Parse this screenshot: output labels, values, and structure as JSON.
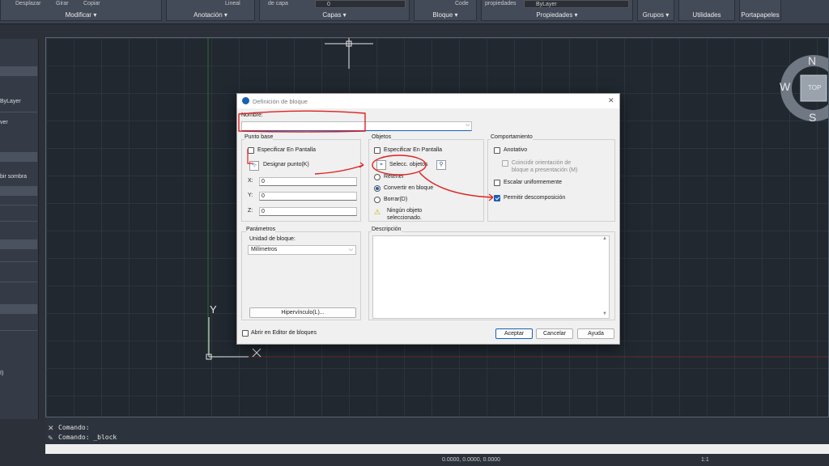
{
  "ribbon": {
    "modify": {
      "title": "Modificar",
      "items": [
        "Desplazar",
        "Girar",
        "Copiar"
      ]
    },
    "annotation": {
      "title": "Anotación",
      "item": "Lineal"
    },
    "layers": {
      "title": "Capas",
      "item": "de capa",
      "layer_value": "0"
    },
    "block": {
      "title": "Bloque",
      "item": "Code"
    },
    "properties": {
      "title": "Propiedades",
      "item": "propiedades",
      "value": "ByLayer"
    },
    "groups": {
      "title": "Grupos"
    },
    "utilities": {
      "title": "Utilidades"
    },
    "clipboard": {
      "title": "Portapapeles"
    }
  },
  "left_palette": {
    "items": [
      "ByLayer",
      "ver",
      "bir sombra",
      "I)"
    ]
  },
  "viewcube": {
    "top": "TOP",
    "north": "N",
    "west": "W",
    "south": "S"
  },
  "ucs": {
    "x": "X",
    "y": "Y"
  },
  "command": {
    "lines": [
      "Comando:",
      "Comando: _block"
    ]
  },
  "status": {
    "coords": "0.0000, 0.0000, 0.0000",
    "scale": "1:1"
  },
  "dialog": {
    "title": "Definición de bloque",
    "name_label": "Nombre:",
    "name_value": "",
    "base_point": {
      "title": "Punto base",
      "specify_label": "Especificar En Pantalla",
      "specify_checked": false,
      "pick_label": "Designar punto(K)",
      "x_label": "X:",
      "x_value": "0",
      "y_label": "Y:",
      "y_value": "0",
      "z_label": "Z:",
      "z_value": "0"
    },
    "objects": {
      "title": "Objetos",
      "specify_label": "Especificar En Pantalla",
      "specify_checked": false,
      "select_label": "Selecc. objetos",
      "retain_label": "Retener",
      "convert_label": "Convertir en bloque",
      "delete_label": "Borrar(D)",
      "selected_option": "convert",
      "warning_text_1": "Ningún objeto",
      "warning_text_2": "seleccionado."
    },
    "behavior": {
      "title": "Comportamiento",
      "annotative_label": "Anotativo",
      "annotative_checked": false,
      "match_orient_1": "Coincidir orientación de",
      "match_orient_2": "bloque a presentación (M)",
      "scale_uniform_label": "Escalar uniformemente",
      "scale_uniform_checked": false,
      "allow_explode_label": "Permitir descomposición",
      "allow_explode_checked": true
    },
    "parameters": {
      "title": "Parámetros",
      "unit_label": "Unidad de bloque:",
      "unit_value": "Milímetros",
      "hyperlink_label": "Hipervínculo(L)..."
    },
    "description": {
      "title": "Descripción",
      "value": ""
    },
    "open_editor_label": "Abrir en Editor de bloques",
    "open_editor_checked": false,
    "buttons": {
      "ok": "Aceptar",
      "cancel": "Cancelar",
      "help": "Ayuda"
    }
  },
  "colors": {
    "annotation_red": "#e02020",
    "accent_blue": "#1a5fb4"
  }
}
